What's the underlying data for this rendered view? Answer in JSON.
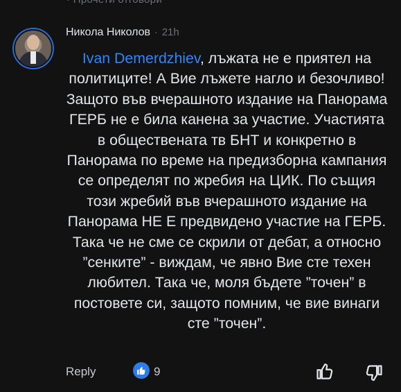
{
  "previous_comment": {
    "cut_text": "· Прочети отговори"
  },
  "comment": {
    "author": "Никола Николов",
    "separator": "·",
    "time": "21h",
    "mention": "Ivan Demerdzhiev",
    "text": ", лъжата не е приятел на политиците! А Вие лъжете нагло и безочливо! Защото във вчерашното издание на Панорама ГЕРБ не е била канена за участие. Участията в обществената тв БНТ и конкретно в Панорама по време на предизборна кампания се определят по жребия на ЦИК. По същия този жребий във вчерашното издание на Панорама НЕ Е предвидено участие на ГЕРБ. Така че не сме се скрили от дебат, а относно ”сенките” - виждам, че явно Вие сте техен любител. Така че, моля бъдете ”точен” в постовете си, защото помним, че вие винаги сте ”точен”."
  },
  "actions": {
    "reply_label": "Reply",
    "like_count": "9",
    "like_badge_icon": "thumbs-up-icon",
    "upvote_icon": "thumbs-up-outline-icon",
    "downvote_icon": "thumbs-down-outline-icon"
  },
  "colors": {
    "background": "#121213",
    "text": "#e4e6eb",
    "muted": "#6e7075",
    "mention": "#2f86f6",
    "like_badge": "#2e7de7",
    "avatar_ring": "#2c6bd6"
  }
}
